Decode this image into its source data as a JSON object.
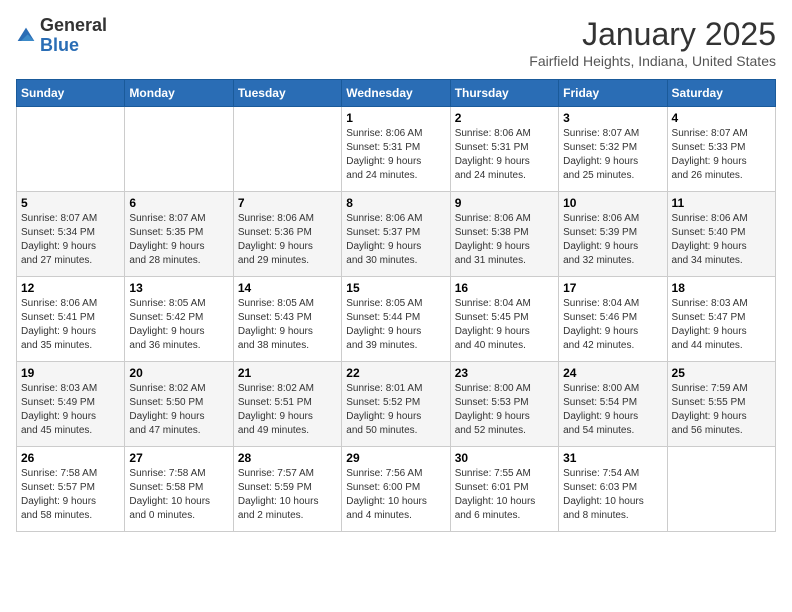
{
  "logo": {
    "general": "General",
    "blue": "Blue"
  },
  "header": {
    "month": "January 2025",
    "location": "Fairfield Heights, Indiana, United States"
  },
  "days_of_week": [
    "Sunday",
    "Monday",
    "Tuesday",
    "Wednesday",
    "Thursday",
    "Friday",
    "Saturday"
  ],
  "weeks": [
    [
      {
        "day": "",
        "info": ""
      },
      {
        "day": "",
        "info": ""
      },
      {
        "day": "",
        "info": ""
      },
      {
        "day": "1",
        "info": "Sunrise: 8:06 AM\nSunset: 5:31 PM\nDaylight: 9 hours\nand 24 minutes."
      },
      {
        "day": "2",
        "info": "Sunrise: 8:06 AM\nSunset: 5:31 PM\nDaylight: 9 hours\nand 24 minutes."
      },
      {
        "day": "3",
        "info": "Sunrise: 8:07 AM\nSunset: 5:32 PM\nDaylight: 9 hours\nand 25 minutes."
      },
      {
        "day": "4",
        "info": "Sunrise: 8:07 AM\nSunset: 5:33 PM\nDaylight: 9 hours\nand 26 minutes."
      }
    ],
    [
      {
        "day": "5",
        "info": "Sunrise: 8:07 AM\nSunset: 5:34 PM\nDaylight: 9 hours\nand 27 minutes."
      },
      {
        "day": "6",
        "info": "Sunrise: 8:07 AM\nSunset: 5:35 PM\nDaylight: 9 hours\nand 28 minutes."
      },
      {
        "day": "7",
        "info": "Sunrise: 8:06 AM\nSunset: 5:36 PM\nDaylight: 9 hours\nand 29 minutes."
      },
      {
        "day": "8",
        "info": "Sunrise: 8:06 AM\nSunset: 5:37 PM\nDaylight: 9 hours\nand 30 minutes."
      },
      {
        "day": "9",
        "info": "Sunrise: 8:06 AM\nSunset: 5:38 PM\nDaylight: 9 hours\nand 31 minutes."
      },
      {
        "day": "10",
        "info": "Sunrise: 8:06 AM\nSunset: 5:39 PM\nDaylight: 9 hours\nand 32 minutes."
      },
      {
        "day": "11",
        "info": "Sunrise: 8:06 AM\nSunset: 5:40 PM\nDaylight: 9 hours\nand 34 minutes."
      }
    ],
    [
      {
        "day": "12",
        "info": "Sunrise: 8:06 AM\nSunset: 5:41 PM\nDaylight: 9 hours\nand 35 minutes."
      },
      {
        "day": "13",
        "info": "Sunrise: 8:05 AM\nSunset: 5:42 PM\nDaylight: 9 hours\nand 36 minutes."
      },
      {
        "day": "14",
        "info": "Sunrise: 8:05 AM\nSunset: 5:43 PM\nDaylight: 9 hours\nand 38 minutes."
      },
      {
        "day": "15",
        "info": "Sunrise: 8:05 AM\nSunset: 5:44 PM\nDaylight: 9 hours\nand 39 minutes."
      },
      {
        "day": "16",
        "info": "Sunrise: 8:04 AM\nSunset: 5:45 PM\nDaylight: 9 hours\nand 40 minutes."
      },
      {
        "day": "17",
        "info": "Sunrise: 8:04 AM\nSunset: 5:46 PM\nDaylight: 9 hours\nand 42 minutes."
      },
      {
        "day": "18",
        "info": "Sunrise: 8:03 AM\nSunset: 5:47 PM\nDaylight: 9 hours\nand 44 minutes."
      }
    ],
    [
      {
        "day": "19",
        "info": "Sunrise: 8:03 AM\nSunset: 5:49 PM\nDaylight: 9 hours\nand 45 minutes."
      },
      {
        "day": "20",
        "info": "Sunrise: 8:02 AM\nSunset: 5:50 PM\nDaylight: 9 hours\nand 47 minutes."
      },
      {
        "day": "21",
        "info": "Sunrise: 8:02 AM\nSunset: 5:51 PM\nDaylight: 9 hours\nand 49 minutes."
      },
      {
        "day": "22",
        "info": "Sunrise: 8:01 AM\nSunset: 5:52 PM\nDaylight: 9 hours\nand 50 minutes."
      },
      {
        "day": "23",
        "info": "Sunrise: 8:00 AM\nSunset: 5:53 PM\nDaylight: 9 hours\nand 52 minutes."
      },
      {
        "day": "24",
        "info": "Sunrise: 8:00 AM\nSunset: 5:54 PM\nDaylight: 9 hours\nand 54 minutes."
      },
      {
        "day": "25",
        "info": "Sunrise: 7:59 AM\nSunset: 5:55 PM\nDaylight: 9 hours\nand 56 minutes."
      }
    ],
    [
      {
        "day": "26",
        "info": "Sunrise: 7:58 AM\nSunset: 5:57 PM\nDaylight: 9 hours\nand 58 minutes."
      },
      {
        "day": "27",
        "info": "Sunrise: 7:58 AM\nSunset: 5:58 PM\nDaylight: 10 hours\nand 0 minutes."
      },
      {
        "day": "28",
        "info": "Sunrise: 7:57 AM\nSunset: 5:59 PM\nDaylight: 10 hours\nand 2 minutes."
      },
      {
        "day": "29",
        "info": "Sunrise: 7:56 AM\nSunset: 6:00 PM\nDaylight: 10 hours\nand 4 minutes."
      },
      {
        "day": "30",
        "info": "Sunrise: 7:55 AM\nSunset: 6:01 PM\nDaylight: 10 hours\nand 6 minutes."
      },
      {
        "day": "31",
        "info": "Sunrise: 7:54 AM\nSunset: 6:03 PM\nDaylight: 10 hours\nand 8 minutes."
      },
      {
        "day": "",
        "info": ""
      }
    ]
  ]
}
